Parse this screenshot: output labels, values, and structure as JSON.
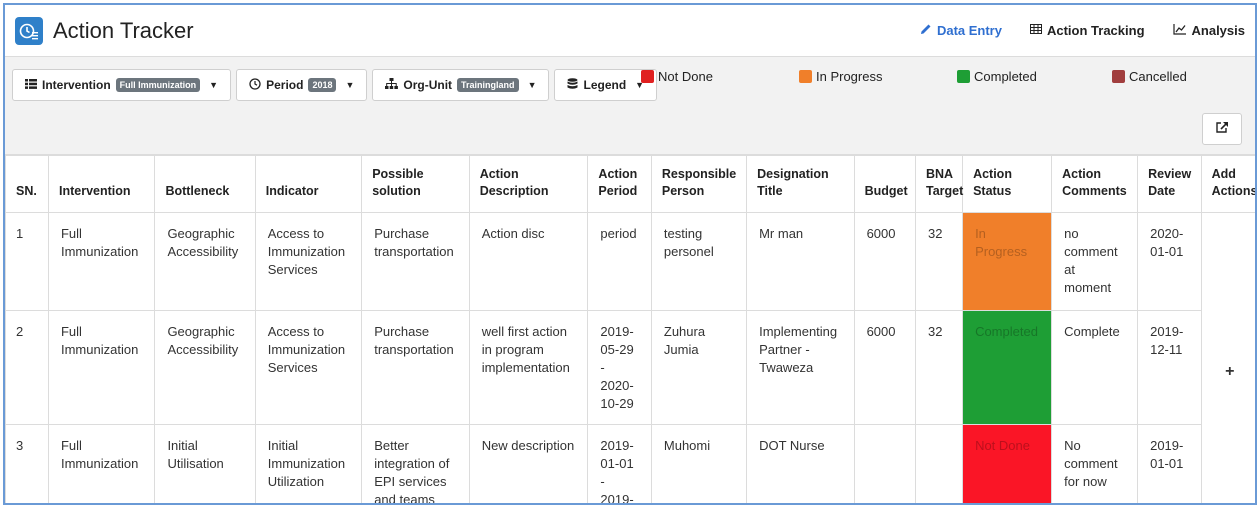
{
  "app": {
    "title": "Action Tracker"
  },
  "nav": [
    {
      "label": "Data Entry",
      "icon": "pencil-icon",
      "active": true
    },
    {
      "label": "Action Tracking",
      "icon": "table-icon",
      "active": false
    },
    {
      "label": "Analysis",
      "icon": "chart-line-icon",
      "active": false
    }
  ],
  "filters": {
    "intervention": {
      "label": "Intervention",
      "value": "Full Immunization"
    },
    "period": {
      "label": "Period",
      "value": "2018"
    },
    "org_unit": {
      "label": "Org-Unit",
      "value": "Trainingland"
    },
    "legend": {
      "label": "Legend"
    }
  },
  "legend": [
    {
      "label": "Not Done",
      "color": "#e02020"
    },
    {
      "label": "In Progress",
      "color": "#f07f2a"
    },
    {
      "label": "Completed",
      "color": "#1e9e35"
    },
    {
      "label": "Cancelled",
      "color": "#a13e3e"
    }
  ],
  "table": {
    "headers": [
      "SN.",
      "Intervention",
      "Bottleneck",
      "Indicator",
      "Possible solution",
      "Action Description",
      "Action Period",
      "Responsible Person",
      "Designation Title",
      "Budget",
      "BNA Target",
      "Action Status",
      "Action Comments",
      "Review Date",
      "Add Actions"
    ],
    "rows": [
      {
        "sn": "1",
        "intervention": "Full Immunization",
        "bottleneck": "Geographic Accessibility",
        "indicator": "Access to Immunization Services",
        "solution": "Purchase transportation",
        "description": "Action disc",
        "period": "period",
        "person": "testing personel",
        "designation": "Mr man",
        "budget": "6000",
        "target": "32",
        "status": "In Progress",
        "status_color": "#f07f2a",
        "comments": "no comment at moment",
        "review": "2020-01-01"
      },
      {
        "sn": "2",
        "intervention": "Full Immunization",
        "bottleneck": "Geographic Accessibility",
        "indicator": "Access to Immunization Services",
        "solution": "Purchase transportation",
        "description": "well first action in program implementation",
        "period": "2019-05-29 - 2020-10-29",
        "person": "Zuhura Jumia",
        "designation": "Implementing Partner - Twaweza",
        "budget": "6000",
        "target": "32",
        "status": "Completed",
        "status_color": "#1e9e35",
        "comments": "Complete",
        "review": "2019-12-11"
      },
      {
        "sn": "3",
        "intervention": "Full Immunization",
        "bottleneck": "Initial Utilisation",
        "indicator": "Initial Immunization Utilization",
        "solution": "Better integration of EPI services and teams",
        "description": "New description",
        "period": "2019-01-01 - 2019-",
        "person": "Muhomi",
        "designation": "DOT Nurse",
        "budget": "",
        "target": "",
        "status": "Not Done",
        "status_color": "#fa1526",
        "comments": "No comment for now",
        "review": "2019-01-01"
      }
    ],
    "add_symbol": "+"
  }
}
